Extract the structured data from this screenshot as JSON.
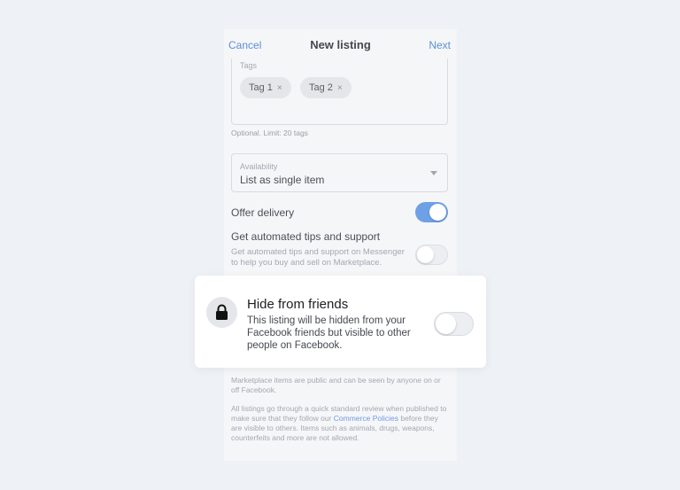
{
  "header": {
    "cancel_label": "Cancel",
    "title": "New listing",
    "next_label": "Next"
  },
  "tags": {
    "label": "Tags",
    "items": [
      "Tag 1",
      "Tag 2"
    ],
    "remove_glyph": "×",
    "hint": "Optional. Limit: 20 tags"
  },
  "availability": {
    "label": "Availability",
    "value": "List as single item"
  },
  "delivery": {
    "label": "Offer delivery",
    "enabled": true
  },
  "tips": {
    "title": "Get automated tips and support",
    "description": "Get automated tips and support on Messenger to help you buy and sell on Marketplace.",
    "enabled": false
  },
  "hide_card": {
    "title": "Hide from friends",
    "description": "This listing will be hidden from your Facebook friends but visible to other people on Facebook.",
    "enabled": false
  },
  "footer": {
    "note1": "Marketplace items are public and can be seen by anyone on or off Facebook.",
    "note2_pre": "All listings go through a quick standard review when published to make sure that they follow our ",
    "note2_link": "Commerce Policies",
    "note2_post": " before they are visible to others. Items such as animals, drugs, weapons, counterfeits and more are not allowed."
  },
  "colors": {
    "accent": "#6ea0e6",
    "link": "#5b8fd6",
    "background": "#eef1f5"
  }
}
